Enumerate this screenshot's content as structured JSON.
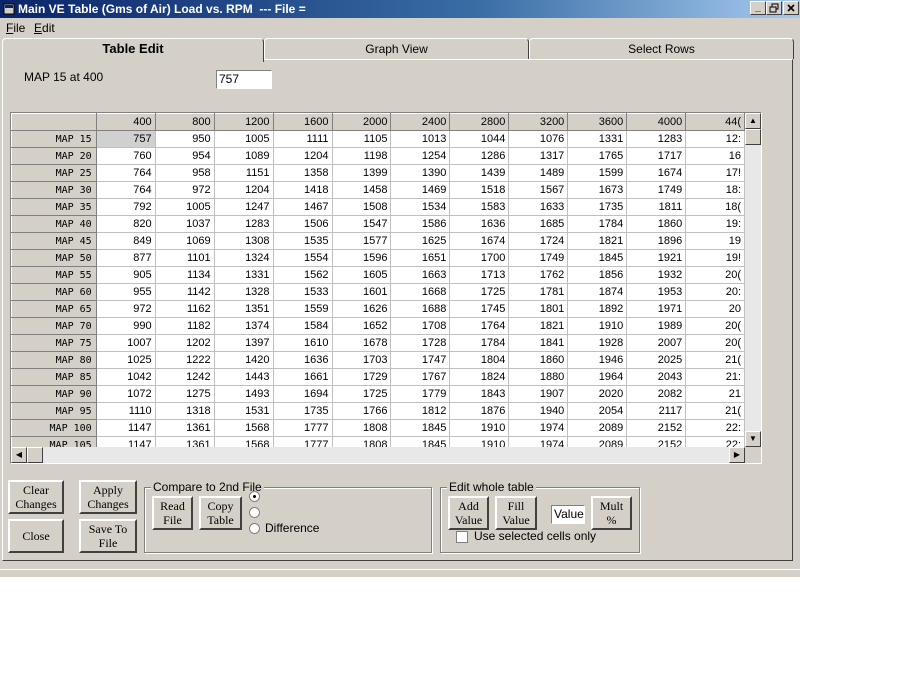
{
  "window": {
    "title": "Main VE Table (Gms of Air) Load vs. RPM  --- File ="
  },
  "menu": [
    {
      "label": "File",
      "hotkey": "F"
    },
    {
      "label": "Edit",
      "hotkey": "E"
    }
  ],
  "tabs": [
    {
      "label": "Table Edit",
      "active": true
    },
    {
      "label": "Graph View",
      "active": false
    },
    {
      "label": "Select Rows",
      "active": false
    }
  ],
  "cell_info": {
    "label": "MAP 15 at 400",
    "value": "757"
  },
  "table": {
    "columns": [
      "400",
      "800",
      "1200",
      "1600",
      "2000",
      "2400",
      "2800",
      "3200",
      "3600",
      "4000",
      "44("
    ],
    "rows": [
      {
        "label": "MAP 15",
        "values": [
          "757",
          "950",
          "1005",
          "1111",
          "1105",
          "1013",
          "1044",
          "1076",
          "1331",
          "1283",
          "12:"
        ]
      },
      {
        "label": "MAP 20",
        "values": [
          "760",
          "954",
          "1089",
          "1204",
          "1198",
          "1254",
          "1286",
          "1317",
          "1765",
          "1717",
          "16"
        ]
      },
      {
        "label": "MAP 25",
        "values": [
          "764",
          "958",
          "1151",
          "1358",
          "1399",
          "1390",
          "1439",
          "1489",
          "1599",
          "1674",
          "17!"
        ]
      },
      {
        "label": "MAP 30",
        "values": [
          "764",
          "972",
          "1204",
          "1418",
          "1458",
          "1469",
          "1518",
          "1567",
          "1673",
          "1749",
          "18:"
        ]
      },
      {
        "label": "MAP 35",
        "values": [
          "792",
          "1005",
          "1247",
          "1467",
          "1508",
          "1534",
          "1583",
          "1633",
          "1735",
          "1811",
          "18("
        ]
      },
      {
        "label": "MAP 40",
        "values": [
          "820",
          "1037",
          "1283",
          "1506",
          "1547",
          "1586",
          "1636",
          "1685",
          "1784",
          "1860",
          "19:"
        ]
      },
      {
        "label": "MAP 45",
        "values": [
          "849",
          "1069",
          "1308",
          "1535",
          "1577",
          "1625",
          "1674",
          "1724",
          "1821",
          "1896",
          "19"
        ]
      },
      {
        "label": "MAP 50",
        "values": [
          "877",
          "1101",
          "1324",
          "1554",
          "1596",
          "1651",
          "1700",
          "1749",
          "1845",
          "1921",
          "19!"
        ]
      },
      {
        "label": "MAP 55",
        "values": [
          "905",
          "1134",
          "1331",
          "1562",
          "1605",
          "1663",
          "1713",
          "1762",
          "1856",
          "1932",
          "20("
        ]
      },
      {
        "label": "MAP 60",
        "values": [
          "955",
          "1142",
          "1328",
          "1533",
          "1601",
          "1668",
          "1725",
          "1781",
          "1874",
          "1953",
          "20:"
        ]
      },
      {
        "label": "MAP 65",
        "values": [
          "972",
          "1162",
          "1351",
          "1559",
          "1626",
          "1688",
          "1745",
          "1801",
          "1892",
          "1971",
          "20"
        ]
      },
      {
        "label": "MAP 70",
        "values": [
          "990",
          "1182",
          "1374",
          "1584",
          "1652",
          "1708",
          "1764",
          "1821",
          "1910",
          "1989",
          "20("
        ]
      },
      {
        "label": "MAP 75",
        "values": [
          "1007",
          "1202",
          "1397",
          "1610",
          "1678",
          "1728",
          "1784",
          "1841",
          "1928",
          "2007",
          "20("
        ]
      },
      {
        "label": "MAP 80",
        "values": [
          "1025",
          "1222",
          "1420",
          "1636",
          "1703",
          "1747",
          "1804",
          "1860",
          "1946",
          "2025",
          "21("
        ]
      },
      {
        "label": "MAP 85",
        "values": [
          "1042",
          "1242",
          "1443",
          "1661",
          "1729",
          "1767",
          "1824",
          "1880",
          "1964",
          "2043",
          "21:"
        ]
      },
      {
        "label": "MAP 90",
        "values": [
          "1072",
          "1275",
          "1493",
          "1694",
          "1725",
          "1779",
          "1843",
          "1907",
          "2020",
          "2082",
          "21"
        ]
      },
      {
        "label": "MAP 95",
        "values": [
          "1110",
          "1318",
          "1531",
          "1735",
          "1766",
          "1812",
          "1876",
          "1940",
          "2054",
          "2117",
          "21("
        ]
      },
      {
        "label": "MAP 100",
        "values": [
          "1147",
          "1361",
          "1568",
          "1777",
          "1808",
          "1845",
          "1910",
          "1974",
          "2089",
          "2152",
          "22:"
        ]
      },
      {
        "label": "MAP 105",
        "values": [
          "1147",
          "1361",
          "1568",
          "1777",
          "1808",
          "1845",
          "1910",
          "1974",
          "2089",
          "2152",
          "22:"
        ]
      }
    ]
  },
  "buttons": {
    "clear_changes": [
      "Clear",
      "Changes"
    ],
    "apply_changes": [
      "Apply",
      "Changes"
    ],
    "close": "Close",
    "save_to_file": [
      "Save To",
      "File"
    ],
    "read_file": [
      "Read",
      "File"
    ],
    "copy_table": [
      "Copy",
      "Table"
    ],
    "add_value": [
      "Add",
      "Value"
    ],
    "fill_value": [
      "Fill",
      "Value"
    ],
    "mult_percent": [
      "Mult",
      "%"
    ]
  },
  "compare_group": {
    "label": "Compare to 2nd File",
    "difference_label": "Difference"
  },
  "edit_group": {
    "label": "Edit whole table",
    "value_field": "Value",
    "selected_only_label": "Use selected cells only",
    "selected_only_checked": false
  }
}
